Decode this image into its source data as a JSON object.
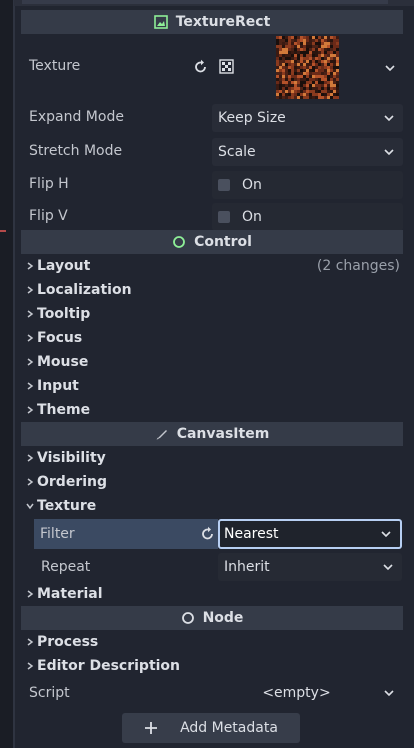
{
  "texture_rect": {
    "header": "TextureRect",
    "texture_label": "Texture",
    "expand_mode_label": "Expand Mode",
    "expand_mode_value": "Keep Size",
    "stretch_mode_label": "Stretch Mode",
    "stretch_mode_value": "Scale",
    "flip_h_label": "Flip H",
    "flip_h_value": "On",
    "flip_v_label": "Flip V",
    "flip_v_value": "On"
  },
  "control": {
    "header": "Control",
    "sections": [
      "Layout",
      "Localization",
      "Tooltip",
      "Focus",
      "Mouse",
      "Input",
      "Theme"
    ],
    "layout_note": "(2 changes)"
  },
  "canvas_item": {
    "header": "CanvasItem",
    "sections": [
      "Visibility",
      "Ordering",
      "Texture"
    ],
    "filter_label": "Filter",
    "filter_value": "Nearest",
    "repeat_label": "Repeat",
    "repeat_value": "Inherit",
    "material_label": "Material"
  },
  "node": {
    "header": "Node",
    "sections": [
      "Process",
      "Editor Description"
    ],
    "script_label": "Script",
    "script_value": "<empty>",
    "add_metadata_label": "Add Metadata"
  },
  "colors": {
    "accent_green": "#8eef97",
    "accent_blue": "#b7cff3",
    "header_bg": "#353b48",
    "panel_bg": "#212530"
  },
  "icons": [
    "texture-rect-icon",
    "revert-icon",
    "clear-icon",
    "chevron-down-icon",
    "control-icon",
    "canvas-item-icon",
    "node-icon",
    "plus-icon",
    "chevron-right-icon"
  ]
}
